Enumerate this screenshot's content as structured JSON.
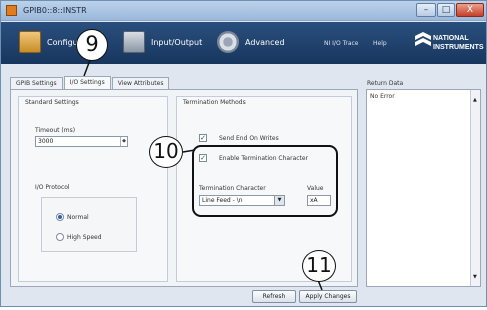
{
  "window": {
    "title": "GPIB0::8::INSTR",
    "minimize": "–",
    "maximize": "□",
    "close": "X"
  },
  "toolbar": {
    "configure_label": "Configure",
    "io_label": "Input/Output",
    "advanced_label": "Advanced",
    "ni_io_trace": "NI I/O Trace",
    "help": "Help",
    "logo_line1": "NATIONAL",
    "logo_line2": "INSTRUMENTS"
  },
  "tabs": [
    {
      "label": "GPIB Settings"
    },
    {
      "label": "I/O Settings"
    },
    {
      "label": "View Attributes"
    }
  ],
  "standard_settings": {
    "title": "Standard Settings",
    "timeout_label": "Timeout (ms)",
    "timeout_value": "3000",
    "io_protocol_label": "I/O Protocol",
    "protocol_options": [
      "Normal",
      "High Speed"
    ],
    "protocol_selected": "Normal"
  },
  "termination": {
    "title": "Termination Methods",
    "send_end_label": "Send End On Writes",
    "send_end_checked": true,
    "enable_term_label": "Enable Termination Character",
    "enable_term_checked": true,
    "term_char_label": "Termination Character",
    "term_char_value": "Line Feed - \\n",
    "value_label": "Value",
    "value_value": "xA"
  },
  "buttons": {
    "refresh": "Refresh",
    "apply": "Apply Changes"
  },
  "return_data": {
    "label": "Return Data",
    "text": "No Error"
  },
  "callouts": {
    "c9": "9",
    "c10": "10",
    "c11": "11"
  }
}
